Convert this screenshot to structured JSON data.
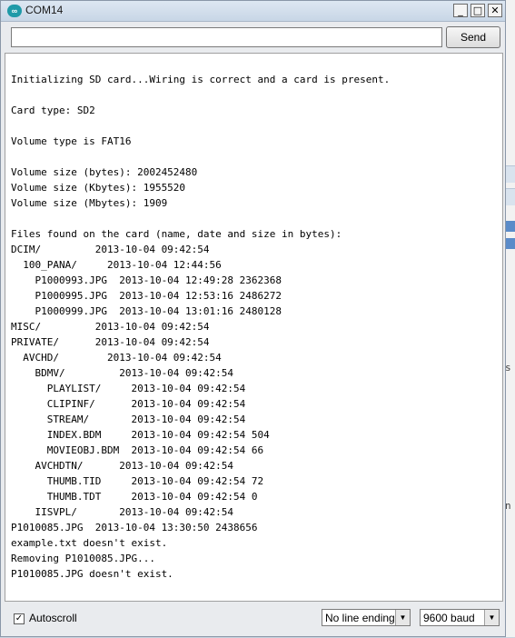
{
  "window": {
    "title": "COM14",
    "icon_label": "∞",
    "controls": {
      "minimize": "_",
      "maximize": "□",
      "close": "✕"
    }
  },
  "send_bar": {
    "input_value": "",
    "send_label": "Send"
  },
  "console": {
    "lines": [
      "Initializing SD card...Wiring is correct and a card is present.",
      "",
      "Card type: SD2",
      "",
      "Volume type is FAT16",
      "",
      "Volume size (bytes): 2002452480",
      "Volume size (Kbytes): 1955520",
      "Volume size (Mbytes): 1909",
      "",
      "Files found on the card (name, date and size in bytes):",
      "DCIM/         2013-10-04 09:42:54",
      "  100_PANA/     2013-10-04 12:44:56",
      "    P1000993.JPG  2013-10-04 12:49:28 2362368",
      "    P1000995.JPG  2013-10-04 12:53:16 2486272",
      "    P1000999.JPG  2013-10-04 13:01:16 2480128",
      "MISC/         2013-10-04 09:42:54",
      "PRIVATE/      2013-10-04 09:42:54",
      "  AVCHD/        2013-10-04 09:42:54",
      "    BDMV/         2013-10-04 09:42:54",
      "      PLAYLIST/     2013-10-04 09:42:54",
      "      CLIPINF/      2013-10-04 09:42:54",
      "      STREAM/       2013-10-04 09:42:54",
      "      INDEX.BDM     2013-10-04 09:42:54 504",
      "      MOVIEOBJ.BDM  2013-10-04 09:42:54 66",
      "    AVCHDTN/      2013-10-04 09:42:54",
      "      THUMB.TID     2013-10-04 09:42:54 72",
      "      THUMB.TDT     2013-10-04 09:42:54 0",
      "    IISVPL/       2013-10-04 09:42:54",
      "P1010085.JPG  2013-10-04 13:30:50 2438656",
      "example.txt doesn't exist.",
      "Removing P1010085.JPG...",
      "P1010085.JPG doesn't exist."
    ]
  },
  "bottom_bar": {
    "autoscroll_label": "Autoscroll",
    "autoscroll_checked": "✓",
    "line_ending": "No line ending",
    "baud_rate": "9600 baud",
    "dropdown_arrow": "▼"
  },
  "background_window": {
    "glyphs": [
      "s",
      "n"
    ]
  }
}
